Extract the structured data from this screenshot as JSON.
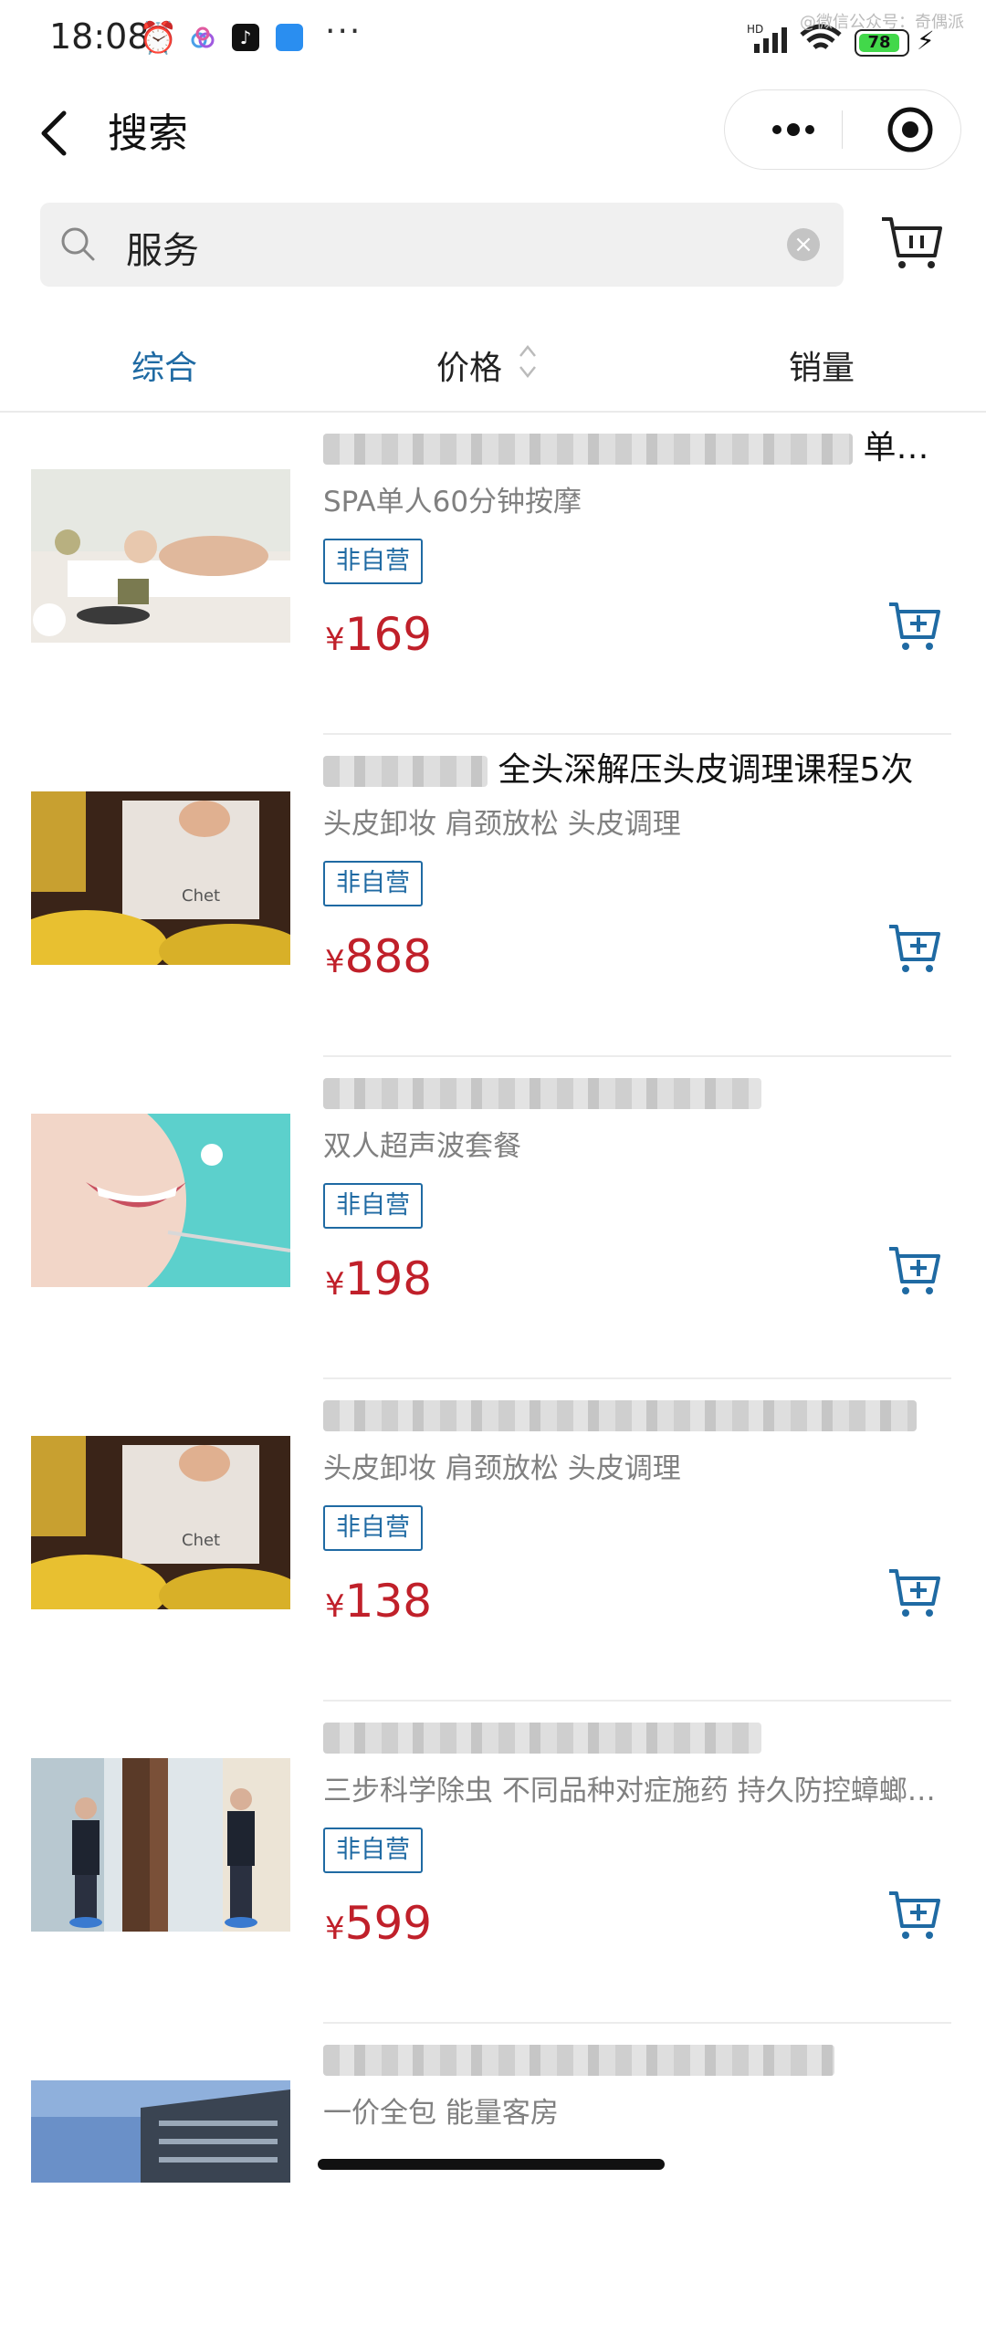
{
  "status_bar": {
    "time": "18:08",
    "watermark": "@微信公众号：奇偶派",
    "battery": "78",
    "network": "HD"
  },
  "nav": {
    "title": "搜索"
  },
  "search": {
    "value": "服务"
  },
  "sort_tabs": [
    {
      "label": "综合",
      "active": true
    },
    {
      "label": "价格",
      "active": false
    },
    {
      "label": "销量",
      "active": false
    }
  ],
  "products": [
    {
      "name_visible": "单…",
      "desc": "SPA单人60分钟按摩",
      "tag": "非自营",
      "currency": "¥",
      "price": "169",
      "image": "spa-massage"
    },
    {
      "name_visible": "全头深解压头皮调理课程5次",
      "desc": "头皮卸妆 肩颈放松 头皮调理",
      "tag": "非自营",
      "currency": "¥",
      "price": "888",
      "image": "head-spa"
    },
    {
      "name_visible": "",
      "desc": "双人超声波套餐",
      "tag": "非自营",
      "currency": "¥",
      "price": "198",
      "image": "dental-smile"
    },
    {
      "name_visible": "",
      "desc": "头皮卸妆 肩颈放松 头皮调理",
      "tag": "非自营",
      "currency": "¥",
      "price": "138",
      "image": "head-spa"
    },
    {
      "name_visible": "",
      "desc": "三步科学除虫 不同品种对症施药 持久防控蟑螂…",
      "tag": "非自营",
      "currency": "¥",
      "price": "599",
      "image": "pest-control"
    },
    {
      "name_visible": "",
      "desc": "一价全包 能量客房",
      "tag": "",
      "currency": "",
      "price": "",
      "image": "hotel-building"
    }
  ],
  "colors": {
    "accent": "#1f6aa3",
    "price": "#c0202a"
  }
}
